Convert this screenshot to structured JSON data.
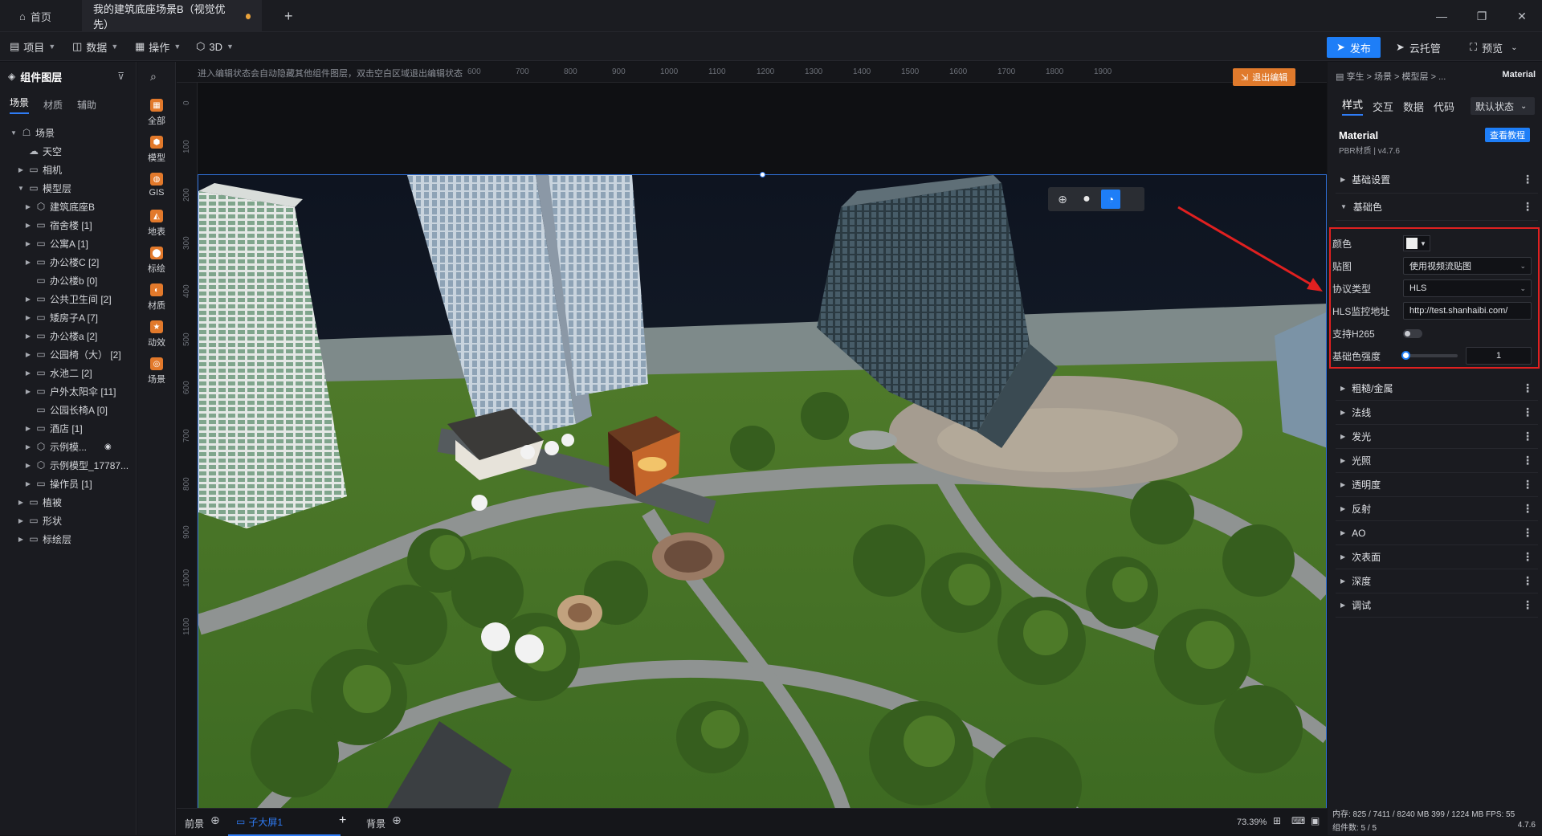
{
  "titlebar": {
    "home_tab": "首页",
    "project_tab": "我的建筑底座场景B（视觉优先）",
    "new_tab": "+"
  },
  "menubar": {
    "items": [
      {
        "label": "项目",
        "icon": "file-icon"
      },
      {
        "label": "数据",
        "icon": "database-icon"
      },
      {
        "label": "操作",
        "icon": "grid-icon"
      },
      {
        "label": "3D",
        "icon": "cube-icon"
      }
    ],
    "publish": "发布",
    "cloud": "云托管",
    "preview": "预览",
    "accent_color": "#1e7ef7"
  },
  "leftpanel": {
    "title": "组件图层",
    "tabs": [
      "场景",
      "材质",
      "辅助"
    ],
    "tree": [
      {
        "label": "场景",
        "level": 0,
        "expanded": true,
        "icon": "scene-icon"
      },
      {
        "label": "天空",
        "level": 1,
        "icon": "sky-icon"
      },
      {
        "label": "相机",
        "level": 1,
        "collapsed": true,
        "icon": "folder-icon"
      },
      {
        "label": "模型层",
        "level": 1,
        "expanded": true,
        "icon": "folder-icon"
      },
      {
        "label": "建筑底座B",
        "level": 2,
        "collapsed": true,
        "icon": "model-icon"
      },
      {
        "label": "宿舍楼 [1]",
        "level": 2,
        "collapsed": true,
        "icon": "folder-icon"
      },
      {
        "label": "公寓A [1]",
        "level": 2,
        "collapsed": true,
        "icon": "folder-icon"
      },
      {
        "label": "办公楼C [2]",
        "level": 2,
        "collapsed": true,
        "icon": "folder-icon"
      },
      {
        "label": "办公楼b [0]",
        "level": 2,
        "icon": "folder-icon"
      },
      {
        "label": "公共卫生间 [2]",
        "level": 2,
        "collapsed": true,
        "icon": "folder-icon"
      },
      {
        "label": "矮房子A [7]",
        "level": 2,
        "collapsed": true,
        "icon": "folder-icon"
      },
      {
        "label": "办公楼a [2]",
        "level": 2,
        "collapsed": true,
        "icon": "folder-icon"
      },
      {
        "label": "公园椅（大） [2]",
        "level": 2,
        "collapsed": true,
        "icon": "folder-icon"
      },
      {
        "label": "水池二 [2]",
        "level": 2,
        "collapsed": true,
        "icon": "folder-icon"
      },
      {
        "label": "户外太阳伞 [11]",
        "level": 2,
        "collapsed": true,
        "icon": "folder-icon"
      },
      {
        "label": "公园长椅A [0]",
        "level": 2,
        "icon": "folder-icon"
      },
      {
        "label": "酒店 [1]",
        "level": 2,
        "collapsed": true,
        "icon": "folder-icon"
      },
      {
        "label": "示例模...",
        "level": 2,
        "collapsed": true,
        "icon": "model-icon",
        "hidden": true
      },
      {
        "label": "示例模型_17787...",
        "level": 2,
        "collapsed": true,
        "icon": "model-icon"
      },
      {
        "label": "操作员 [1]",
        "level": 2,
        "collapsed": true,
        "icon": "folder-icon"
      },
      {
        "label": "植被",
        "level": 1,
        "collapsed": true,
        "icon": "folder-icon"
      },
      {
        "label": "形状",
        "level": 1,
        "collapsed": true,
        "icon": "folder-icon"
      },
      {
        "label": "标绘层",
        "level": 1,
        "collapsed": true,
        "icon": "folder-icon"
      }
    ]
  },
  "rail": {
    "items": [
      {
        "label": "全部",
        "icon": "grid-icon",
        "color": "#e2792b"
      },
      {
        "label": "模型",
        "icon": "model-icon",
        "color": "#e2792b"
      },
      {
        "label": "GIS",
        "icon": "globe-icon",
        "color": "#e2792b"
      },
      {
        "label": "地表",
        "icon": "terrain-icon",
        "color": "#e2792b"
      },
      {
        "label": "标绘",
        "icon": "pin-icon",
        "color": "#e2792b"
      },
      {
        "label": "材质",
        "icon": "material-icon",
        "color": "#e2792b"
      },
      {
        "label": "动效",
        "icon": "star-icon",
        "color": "#e2792b"
      },
      {
        "label": "场景",
        "icon": "scene-icon",
        "color": "#e2792b"
      }
    ]
  },
  "canvas": {
    "hint": "进入编辑状态会自动隐藏其他组件图层，双击空白区域退出编辑状态",
    "exit_button": "退出编辑",
    "hruler_ticks": [
      "600",
      "700",
      "800",
      "900",
      "1000",
      "1100",
      "1200",
      "1300",
      "1400",
      "1500",
      "1600",
      "1700",
      "1800",
      "1900"
    ],
    "vruler_ticks": [
      "0",
      "100",
      "200",
      "300",
      "400",
      "500",
      "600",
      "700",
      "800",
      "900",
      "1000",
      "1100"
    ]
  },
  "bottombar": {
    "front_tab": "前景",
    "screen_tab": "子大屏1",
    "back_tab": "背景",
    "zoom": "73.39%"
  },
  "rightpanel": {
    "breadcrumb": "孪生 > 场景 > 模型层 > ...",
    "breadcrumb_end": "Material",
    "tabs": [
      "样式",
      "交互",
      "数据",
      "代码"
    ],
    "state_select": "默认状态",
    "material_name": "Material",
    "material_sub": "PBR材质 | v4.7.6",
    "tutorial_btn": "查看教程",
    "sections_top": [
      "基础设置",
      "基础色"
    ],
    "props": {
      "color_label": "颜色",
      "map_label": "贴图",
      "map_value": "使用视频流贴图",
      "protocol_label": "协议类型",
      "protocol_value": "HLS",
      "url_label": "HLS监控地址",
      "url_value": "http://test.shanhaibi.com/",
      "h265_label": "支持H265",
      "strength_label": "基础色强度",
      "strength_value": "1"
    },
    "sections_bottom": [
      "粗糙/金属",
      "法线",
      "发光",
      "光照",
      "透明度",
      "反射",
      "AO",
      "次表面",
      "深度",
      "调试"
    ],
    "status_line": "内存: 825 / 7411 / 8240 MB 399 / 1224 MB FPS: 55",
    "component_count": "组件数: 5 / 5",
    "version": "4.7.6",
    "highlight_color": "#e02020"
  }
}
